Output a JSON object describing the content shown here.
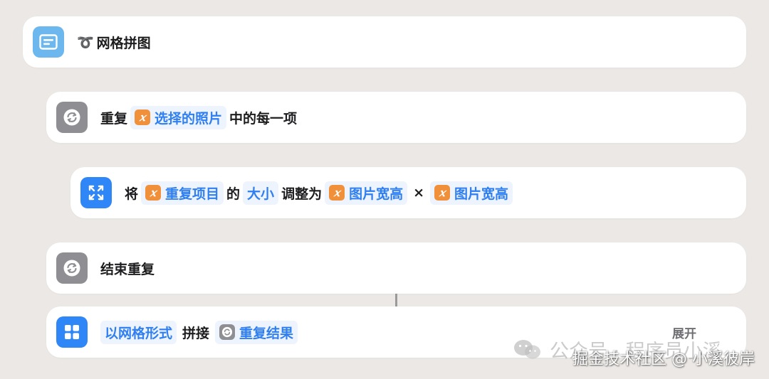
{
  "title_card": {
    "icon": "text-box-icon",
    "loop_glyph": "➰",
    "label": "网格拼图"
  },
  "repeat_card": {
    "icon": "repeat-icon",
    "prefix": "重复",
    "variable": {
      "badge": "𝑥",
      "label": "选择的照片"
    },
    "suffix": "中的每一项"
  },
  "resize_card": {
    "icon": "resize-arrows-icon",
    "word_jiang": "将",
    "var1": {
      "badge": "𝑥",
      "label": "重复项目"
    },
    "word_de": "的",
    "property": "大小",
    "word_adjust": "调整为",
    "var2": {
      "badge": "𝑥",
      "label": "图片宽高"
    },
    "times": "×",
    "var3": {
      "badge": "𝑥",
      "label": "图片宽高"
    }
  },
  "end_card": {
    "icon": "repeat-icon",
    "label": "结束重复"
  },
  "combine_card": {
    "icon": "grid-icon",
    "mode": "以网格形式",
    "word_combine": "拼接",
    "result": {
      "badge": "repeat-icon",
      "label": "重复结果"
    },
    "expand_label": "展开"
  },
  "watermark": {
    "icon": "wechat-icon",
    "text": "公众号 · 程序员小溪"
  },
  "credit": "掘金技术社区 @ 小溪彼岸",
  "colors": {
    "background": "#ebe8e5",
    "card": "#ffffff",
    "variable_orange": "#f0903a",
    "token_blue": "#2f7ff0",
    "action_blue": "#2f86f6",
    "action_gray": "#8e8e93",
    "text_icon_blue": "#6cb8ee"
  }
}
